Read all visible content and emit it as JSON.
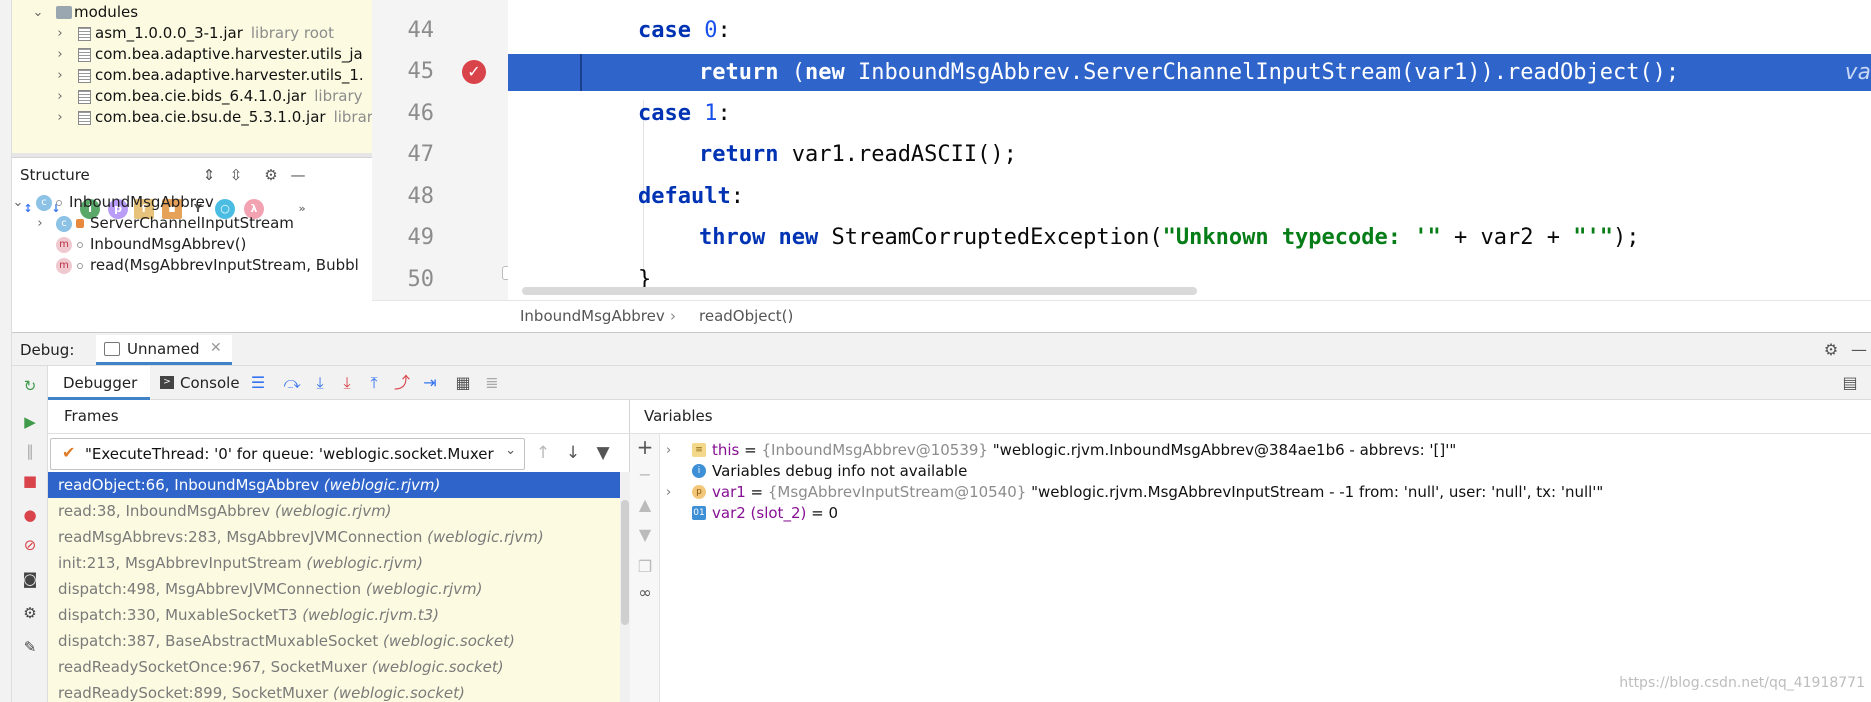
{
  "project_tree": {
    "modules_label": "modules",
    "jars": [
      {
        "name": "asm_1.0.0.0_3-1.jar",
        "hint": "library root"
      },
      {
        "name": "com.bea.adaptive.harvester.utils_ja",
        "hint": ""
      },
      {
        "name": "com.bea.adaptive.harvester.utils_1.",
        "hint": ""
      },
      {
        "name": "com.bea.cie.bids_6.4.1.0.jar",
        "hint": "library"
      },
      {
        "name": "com.bea.cie.bsu.de_5.3.1.0.jar",
        "hint": "librar"
      }
    ]
  },
  "structure": {
    "title": "Structure",
    "items": [
      {
        "label": "InboundMsgAbbrev"
      },
      {
        "label": "ServerChannelInputStream"
      },
      {
        "label": "InboundMsgAbbrev()"
      },
      {
        "label": "read(MsgAbbrevInputStream, Bubbl"
      }
    ],
    "toolbar_icons": [
      "sort-by-visibility-icon",
      "sort-alpha-icon",
      "show-inherited-icon",
      "show-properties-icon",
      "show-fields-icon",
      "show-non-public-icon",
      "show-anonymous-icon",
      "show-lambdas-icon",
      "more-icon"
    ]
  },
  "editor": {
    "line_numbers": [
      "44",
      "45",
      "46",
      "47",
      "48",
      "49",
      "50"
    ],
    "lines": {
      "l44": {
        "kw": "case",
        "num": "0",
        "rest": ":"
      },
      "l45": {
        "kw1": "return",
        "p1": " (",
        "kw2": "new",
        "p2": " InboundMsgAbbrev.ServerChannelInputStream(var1)).readObject();",
        "hint": "va"
      },
      "l46": {
        "kw": "case",
        "num": "1",
        "rest": ":"
      },
      "l47": {
        "kw": "return",
        "rest": " var1.readASCII();"
      },
      "l48": {
        "kw": "default",
        "rest": ":"
      },
      "l49": {
        "kw1": "throw",
        "kw2": "new",
        "p1": " StreamCorruptedException(",
        "s1": "\"Unknown typecode: '\"",
        "p2": " + var2 + ",
        "s2": "\"'\"",
        "p3": ");"
      },
      "l50": {
        "text": "}"
      }
    },
    "breadcrumb": {
      "class": "InboundMsgAbbrev",
      "sep": "›",
      "method": "readObject()"
    }
  },
  "debug": {
    "label": "Debug:",
    "session": "Unnamed",
    "tabs": {
      "debugger": "Debugger",
      "console": "Console"
    },
    "frames": {
      "title": "Frames",
      "thread": "\"ExecuteThread: '0' for queue: 'weblogic.socket.Muxer'\"...",
      "items": [
        {
          "method": "readObject:66, InboundMsgAbbrev",
          "pkg": "(weblogic.rjvm)"
        },
        {
          "method": "read:38, InboundMsgAbbrev",
          "pkg": "(weblogic.rjvm)"
        },
        {
          "method": "readMsgAbbrevs:283, MsgAbbrevJVMConnection",
          "pkg": "(weblogic.rjvm)"
        },
        {
          "method": "init:213, MsgAbbrevInputStream",
          "pkg": "(weblogic.rjvm)"
        },
        {
          "method": "dispatch:498, MsgAbbrevJVMConnection",
          "pkg": "(weblogic.rjvm)"
        },
        {
          "method": "dispatch:330, MuxableSocketT3",
          "pkg": "(weblogic.rjvm.t3)"
        },
        {
          "method": "dispatch:387, BaseAbstractMuxableSocket",
          "pkg": "(weblogic.socket)"
        },
        {
          "method": "readReadySocketOnce:967, SocketMuxer",
          "pkg": "(weblogic.socket)"
        },
        {
          "method": "readReadySocket:899, SocketMuxer",
          "pkg": "(weblogic.socket)"
        }
      ]
    },
    "variables": {
      "title": "Variables",
      "items": [
        {
          "name": "this",
          "eq": " = ",
          "type": "{InboundMsgAbbrev@10539}",
          "value": " \"weblogic.rjvm.InboundMsgAbbrev@384ae1b6 - abbrevs: '[]'\""
        },
        {
          "name": "",
          "eq": "",
          "type": "",
          "value": "Variables debug info not available"
        },
        {
          "name": "var1",
          "eq": " = ",
          "type": "{MsgAbbrevInputStream@10540}",
          "value": " \"weblogic.rjvm.MsgAbbrevInputStream - -1 from: 'null', user: 'null', tx: 'null'\""
        },
        {
          "name": "var2 (slot_2)",
          "eq": " = ",
          "type": "",
          "value": "0"
        }
      ]
    },
    "watermark": "https://blog.csdn.net/qq_41918771"
  },
  "colors": {
    "selection": "#2f65ca",
    "keyword": "#0033b3",
    "string": "#067d17",
    "breakpoint": "#d9434a",
    "library_bg": "#fcfbe1"
  }
}
